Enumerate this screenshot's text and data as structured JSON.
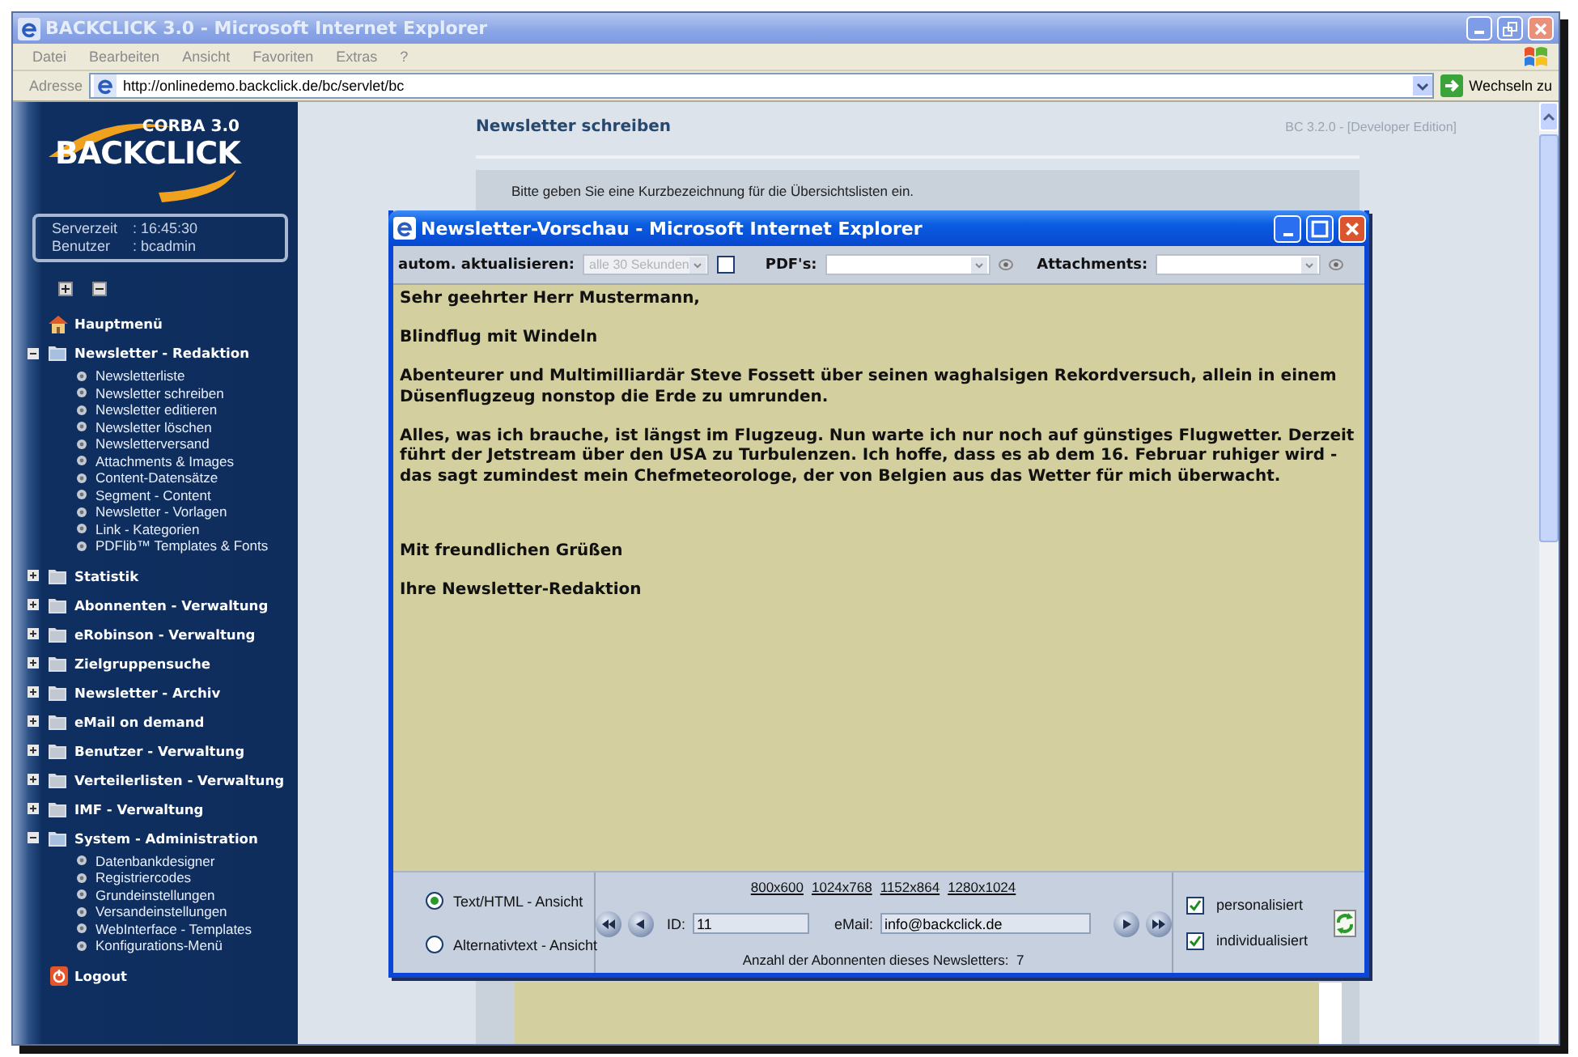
{
  "window": {
    "title": "BACKCLICK 3.0 - Microsoft Internet Explorer"
  },
  "menu": [
    "Datei",
    "Bearbeiten",
    "Ansicht",
    "Favoriten",
    "Extras",
    "?"
  ],
  "address_bar": {
    "label": "Adresse",
    "url": "http://onlinedemo.backclick.de/bc/servlet/bc",
    "go_label": "Wechseln zu"
  },
  "sidebar": {
    "logo": {
      "subtitle": "CORBA 3.0",
      "name": "BACKCLICK"
    },
    "info": [
      {
        "label": "Serverzeit",
        "value": ": 16:45:30"
      },
      {
        "label": "Benutzer",
        "value": ": bcadmin"
      }
    ],
    "menu": [
      {
        "label": "Hauptmenü",
        "kind": "home"
      },
      {
        "label": "Newsletter - Redaktion",
        "kind": "folder",
        "expanded": true,
        "children": [
          {
            "label": "Newsletterliste"
          },
          {
            "label": "Newsletter schreiben"
          },
          {
            "label": "Newsletter editieren"
          },
          {
            "label": "Newsletter löschen"
          },
          {
            "label": "Newsletterversand"
          },
          {
            "label": "Attachments & Images"
          },
          {
            "label": "Content-Datensätze"
          },
          {
            "label": "Segment - Content"
          },
          {
            "label": "Newsletter - Vorlagen"
          },
          {
            "label": "Link - Kategorien"
          },
          {
            "label": "PDFlib™ Templates & Fonts"
          }
        ]
      },
      {
        "label": "Statistik",
        "kind": "folder",
        "expanded": false
      },
      {
        "label": "Abonnenten - Verwaltung",
        "kind": "folder",
        "expanded": false
      },
      {
        "label": "eRobinson - Verwaltung",
        "kind": "folder",
        "expanded": false
      },
      {
        "label": "Zielgruppensuche",
        "kind": "folder",
        "expanded": false
      },
      {
        "label": "Newsletter - Archiv",
        "kind": "folder",
        "expanded": false
      },
      {
        "label": "eMail on demand",
        "kind": "folder",
        "expanded": false
      },
      {
        "label": "Benutzer - Verwaltung",
        "kind": "folder",
        "expanded": false
      },
      {
        "label": "Verteilerlisten - Verwaltung",
        "kind": "folder",
        "expanded": false
      },
      {
        "label": "IMF - Verwaltung",
        "kind": "folder",
        "expanded": false
      },
      {
        "label": "System - Administration",
        "kind": "folder",
        "expanded": true,
        "children": [
          {
            "label": "Datenbankdesigner"
          },
          {
            "label": "Registriercodes"
          },
          {
            "label": "Grundeinstellungen"
          },
          {
            "label": "Versandeinstellungen"
          },
          {
            "label": "WebInterface - Templates"
          },
          {
            "label": "Konfigurations-Menü"
          }
        ]
      },
      {
        "label": "Logout",
        "kind": "logout"
      }
    ]
  },
  "page": {
    "title": "Newsletter schreiben",
    "edition": "BC 3.2.0 - [Developer Edition]",
    "hint": "Bitte geben Sie eine Kurzbezeichnung für die Übersichtslisten ein."
  },
  "popup": {
    "title": "Newsletter-Vorschau - Microsoft Internet Explorer",
    "toolbar": {
      "auto_label": "autom. aktualisieren:",
      "interval": {
        "value": "alle 30 Sekunden",
        "disabled": true
      },
      "auto_checked": false,
      "pdf_label": "PDF's:",
      "attachments_label": "Attachments:"
    },
    "body": [
      "Sehr geehrter Herr Mustermann,",
      "Blindflug mit Windeln",
      "Abenteurer und Multimilliardär Steve Fossett über seinen waghalsigen Rekordversuch, allein in einem Düsenflugzeug nonstop die Erde zu umrunden.",
      "Alles, was ich brauche, ist längst im Flugzeug. Nun warte ich nur noch auf günstiges Flugwetter. Derzeit führt der Jetstream über den USA zu Turbulenzen. Ich hoffe, dass es ab dem 16. Februar ruhiger wird - das sagt zumindest mein Chefmeteorologe, der von Belgien aus das Wetter für mich überwacht."
    ],
    "closing": [
      "Mit freundlichen Grüßen",
      "Ihre Newsletter-Redaktion"
    ],
    "views": [
      {
        "label": "Text/HTML - Ansicht",
        "selected": true
      },
      {
        "label": "Alternativtext - Ansicht",
        "selected": false
      }
    ],
    "resolutions": [
      "800x600",
      "1024x768",
      "1152x864",
      "1280x1024"
    ],
    "id": {
      "label": "ID:",
      "value": "11"
    },
    "email": {
      "label": "eMail:",
      "value": "info@backclick.de"
    },
    "count": "Anzahl der Abonnenten dieses Newsletters:  7",
    "options": [
      {
        "label": "personalisiert",
        "checked": true
      },
      {
        "label": "individualisiert",
        "checked": true
      }
    ]
  }
}
